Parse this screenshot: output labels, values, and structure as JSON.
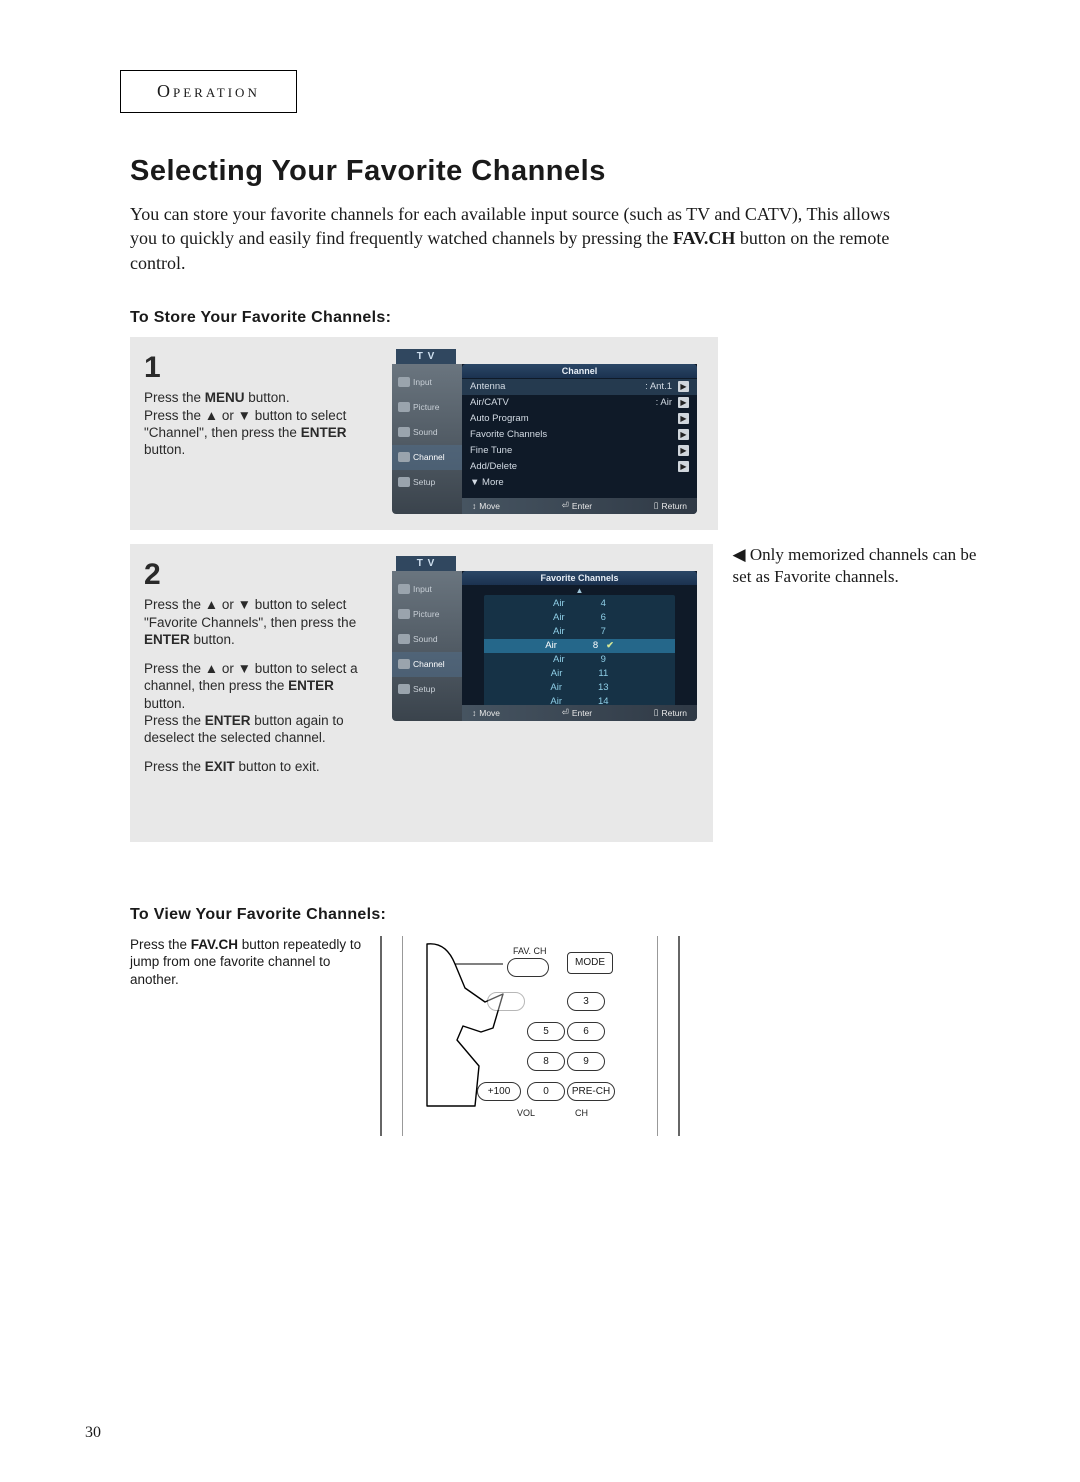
{
  "header": {
    "section": "Operation"
  },
  "title": "Selecting Your Favorite Channels",
  "intro": {
    "p1": "You can store your favorite channels for each available input source (such as TV and CATV), This allows you to quickly and easily find frequently watched channels by pressing the ",
    "bold": "FAV.CH",
    "p2": " button on the remote control."
  },
  "section_store": "To Store Your Favorite Channels:",
  "section_view": "To View Your Favorite Channels:",
  "step1": {
    "num": "1",
    "t1": "Press the ",
    "b1": "MENU",
    "t2": " button.",
    "t3": "Press the ▲ or ▼ button to select \"Channel\", then press the ",
    "b2": "ENTER",
    "t4": " button."
  },
  "step2": {
    "num": "2",
    "t1": "Press the ▲ or ▼ button to select \"Favorite Channels\", then press the ",
    "b1": "ENTER",
    "t2": " button.",
    "t3": "Press the ▲ or ▼ button to select a channel, then press the ",
    "b2": "ENTER",
    "t4": " button.",
    "t5": "Press the ",
    "b3": "ENTER",
    "t6": " button again to deselect the selected channel.",
    "t7": "Press the ",
    "b4": "EXIT",
    "t8": " button to exit."
  },
  "side_note": "◀ Only memorized channels can be set as Favorite channels.",
  "view_step": {
    "t1": "Press the ",
    "b1": "FAV.CH",
    "t2": " button repeatedly to jump from one favorite channel to another."
  },
  "screenshot1": {
    "tv": "T V",
    "title": "Channel",
    "sidebar": [
      "Input",
      "Picture",
      "Sound",
      "Channel",
      "Setup"
    ],
    "rows": [
      {
        "label": "Antenna",
        "value": ": Ant.1",
        "hi": true
      },
      {
        "label": "Air/CATV",
        "value": ": Air"
      },
      {
        "label": "Auto Program",
        "value": ""
      },
      {
        "label": "Favorite Channels",
        "value": ""
      },
      {
        "label": "Fine Tune",
        "value": ""
      },
      {
        "label": "Add/Delete",
        "value": ""
      },
      {
        "label": "▼ More",
        "value": "",
        "noarrow": true
      }
    ],
    "footer": {
      "move": "Move",
      "enter": "Enter",
      "return": "Return"
    }
  },
  "screenshot2": {
    "tv": "T V",
    "title": "Favorite Channels",
    "sidebar": [
      "Input",
      "Picture",
      "Sound",
      "Channel",
      "Setup"
    ],
    "channels": [
      {
        "src": "Air",
        "num": "4"
      },
      {
        "src": "Air",
        "num": "6"
      },
      {
        "src": "Air",
        "num": "7"
      },
      {
        "src": "Air",
        "num": "8",
        "hi": true,
        "check": true
      },
      {
        "src": "Air",
        "num": "9"
      },
      {
        "src": "Air",
        "num": "11"
      },
      {
        "src": "Air",
        "num": "13"
      },
      {
        "src": "Air",
        "num": "14"
      }
    ],
    "footer": {
      "move": "Move",
      "enter": "Enter",
      "return": "Return"
    }
  },
  "remote": {
    "favch": "FAV. CH",
    "mode": "MODE",
    "b3": "3",
    "b5": "5",
    "b6": "6",
    "b8": "8",
    "b9": "9",
    "b0": "0",
    "plus100": "+100",
    "prech": "PRE-CH",
    "vol": "VOL",
    "ch": "CH"
  },
  "page_number": "30"
}
